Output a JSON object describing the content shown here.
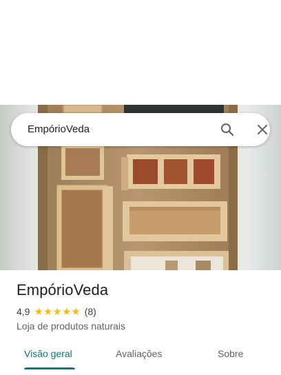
{
  "search": {
    "query": "EmpórioVeda",
    "icons": {
      "search": "search-icon",
      "close": "close-icon"
    }
  },
  "place": {
    "name": "EmpórioVeda",
    "rating": "4,9",
    "stars": 5,
    "review_count": "(8)",
    "category": "Loja de produtos naturais"
  },
  "tabs": [
    {
      "label": "Visão geral",
      "active": true
    },
    {
      "label": "Avaliações",
      "active": false
    },
    {
      "label": "Sobre",
      "active": false
    }
  ],
  "colors": {
    "accent": "#0b7a75",
    "star": "#fbbc04",
    "text_primary": "#202124",
    "text_secondary": "#5f6368"
  }
}
